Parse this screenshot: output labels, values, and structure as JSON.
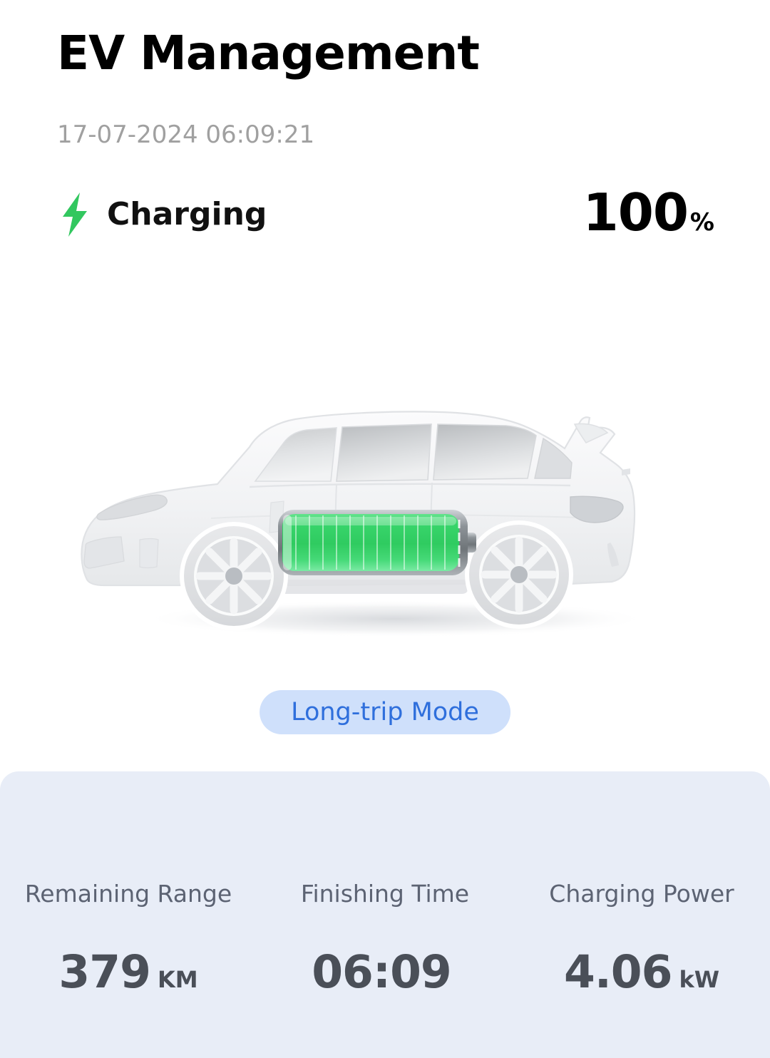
{
  "header": {
    "title": "EV Management",
    "timestamp": "17-07-2024 06:09:21"
  },
  "status": {
    "icon": "lightning-bolt-icon",
    "icon_color": "#32c75f",
    "label": "Charging",
    "battery_percent": "100",
    "battery_percent_unit": "%"
  },
  "vehicle": {
    "icon": "electric-suv-icon",
    "body_color": "#f2f3f5",
    "battery": {
      "icon": "battery-icon",
      "fill_color": "#3ed16a",
      "fill_level_percent": 100,
      "casing_color": "#9aa0a6",
      "segment_count": 13
    }
  },
  "mode": {
    "label": "Long-trip Mode",
    "background_color": "#cfe0fb",
    "text_color": "#2f6fdc"
  },
  "stats": {
    "panel_color": "#e8edf7",
    "items": [
      {
        "label": "Remaining Range",
        "value": "379",
        "unit": "KM"
      },
      {
        "label": "Finishing Time",
        "value": "06:09",
        "unit": ""
      },
      {
        "label": "Charging Power",
        "value": "4.06",
        "unit": "kW"
      }
    ]
  }
}
